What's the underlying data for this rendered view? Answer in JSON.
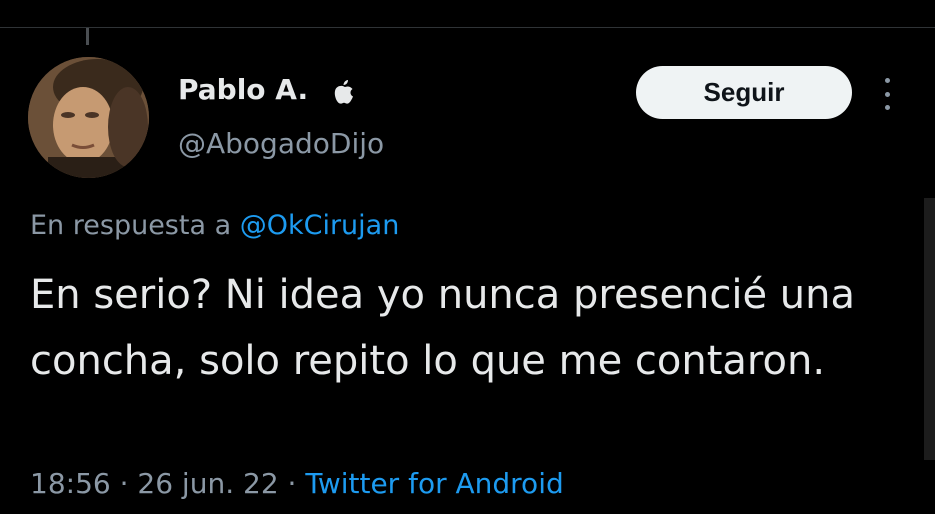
{
  "tweet": {
    "author": {
      "display_name": "Pablo A.",
      "handle": "@AbogadoDijo",
      "badge_icon": "apple-icon",
      "avatar_icon": "avatar-photo"
    },
    "follow_label": "Seguir",
    "more_icon": "more-options-icon",
    "reply": {
      "prefix": "En respuesta a ",
      "mention": "@OkCirujan"
    },
    "text": "En serio? Ni idea yo nunca presencié una concha, solo repito lo que me contaron.",
    "meta": {
      "time": "18:56",
      "date": "26 jun. 22",
      "separator": " · ",
      "source": "Twitter for Android"
    }
  },
  "colors": {
    "background": "#000000",
    "primary_text": "#e7e9ea",
    "secondary_text": "#8b98a5",
    "link": "#1d9bf0",
    "button_bg": "#eff3f4",
    "button_text": "#0f1419"
  }
}
